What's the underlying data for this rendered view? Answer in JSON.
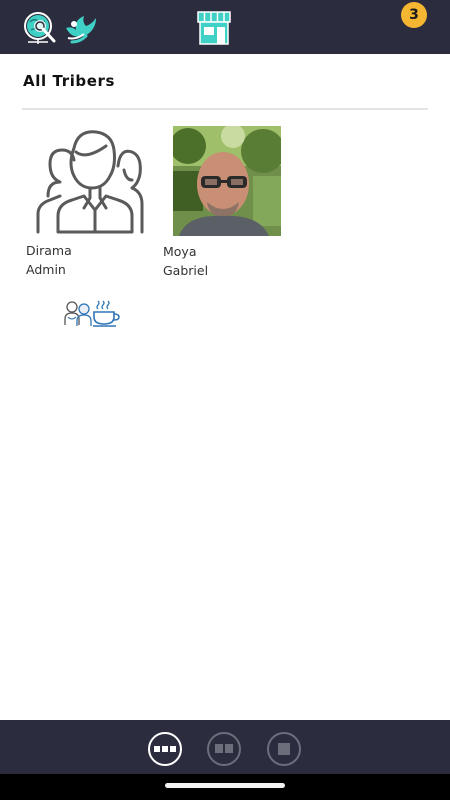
{
  "header": {
    "icons": [
      "globe-search-icon",
      "dove-icon",
      "shop-icon"
    ],
    "notification_count": "3",
    "accent_color": "#3fd0c6",
    "bar_color": "#2b2d3e",
    "badge_color": "#f5b731"
  },
  "section": {
    "title": "All Tribers"
  },
  "members": [
    {
      "first": "Dirama",
      "last": "Admin",
      "avatar": "group-placeholder-icon"
    },
    {
      "first": "Moya",
      "last": "Gabriel",
      "avatar": "profile-photo"
    }
  ],
  "tribe_icons": [
    "people-icon",
    "coffee-cup-icon"
  ],
  "bottom_bar": {
    "view_modes": [
      "three-column-view-icon",
      "two-column-view-icon",
      "single-view-icon"
    ],
    "active_view": "three-column-view-icon"
  }
}
